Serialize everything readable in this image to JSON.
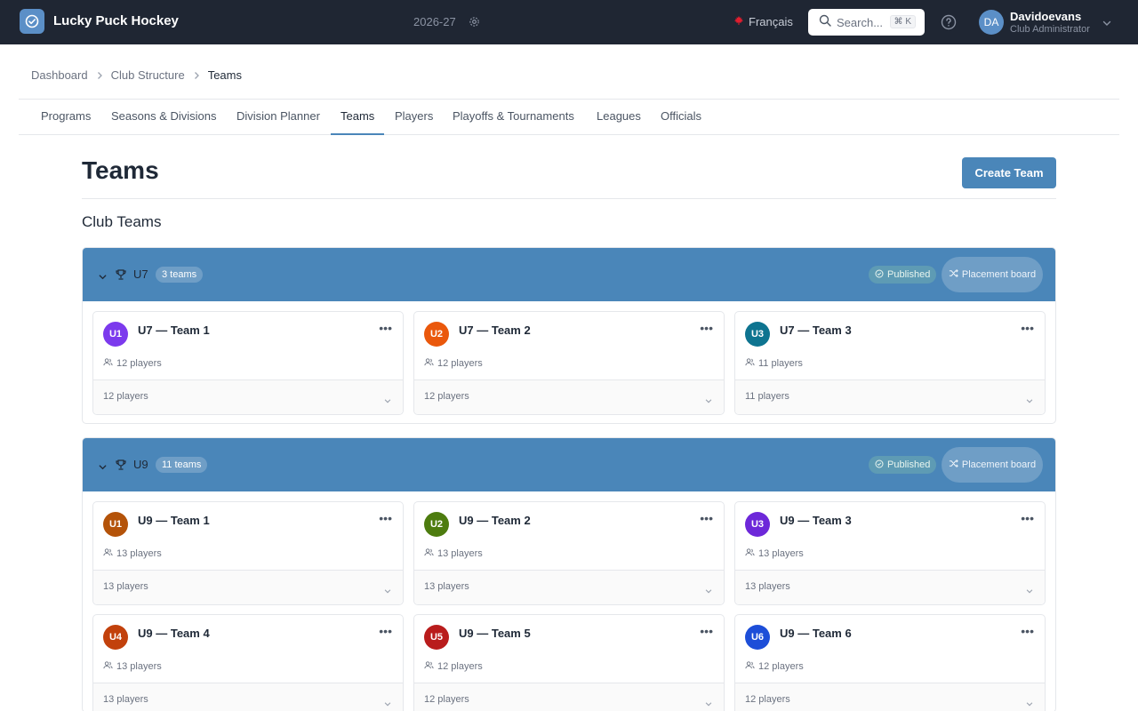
{
  "app": {
    "title": "Lucky Puck Hockey",
    "season": "2026-27"
  },
  "header": {
    "language": "Français",
    "search_placeholder": "Search...",
    "search_shortcut": "⌘ K",
    "user": {
      "initials": "DA",
      "name": "Davidoevans",
      "role": "Club Administrator"
    }
  },
  "breadcrumb": [
    "Dashboard",
    "Club Structure",
    "Teams"
  ],
  "tabs": [
    "Programs",
    "Seasons & Divisions",
    "Division Planner",
    "Teams",
    "Players",
    "Playoffs & Tournaments",
    "Leagues",
    "Officials"
  ],
  "active_tab": "Teams",
  "page": {
    "title": "Teams",
    "create_button": "Create Team",
    "section_title": "Club Teams"
  },
  "divisions": [
    {
      "name": "U7",
      "count_label": "3 teams",
      "status": "Published",
      "placement_label": "Placement board",
      "teams": [
        {
          "badge": "U1",
          "color": "#7c3aed",
          "name": "U7 — Team 1",
          "players": "12 players"
        },
        {
          "badge": "U2",
          "color": "#ea580c",
          "name": "U7 — Team 2",
          "players": "12 players"
        },
        {
          "badge": "U3",
          "color": "#0e7490",
          "name": "U7 — Team 3",
          "players": "11 players"
        }
      ]
    },
    {
      "name": "U9",
      "count_label": "11 teams",
      "status": "Published",
      "placement_label": "Placement board",
      "teams": [
        {
          "badge": "U1",
          "color": "#b45309",
          "name": "U9 — Team 1",
          "players": "13 players"
        },
        {
          "badge": "U2",
          "color": "#4d7c0f",
          "name": "U9 — Team 2",
          "players": "13 players"
        },
        {
          "badge": "U3",
          "color": "#6d28d9",
          "name": "U9 — Team 3",
          "players": "13 players"
        },
        {
          "badge": "U4",
          "color": "#c2410c",
          "name": "U9 — Team 4",
          "players": "13 players"
        },
        {
          "badge": "U5",
          "color": "#b91c1c",
          "name": "U9 — Team 5",
          "players": "12 players"
        },
        {
          "badge": "U6",
          "color": "#1d4ed8",
          "name": "U9 — Team 6",
          "players": "12 players"
        }
      ]
    }
  ]
}
